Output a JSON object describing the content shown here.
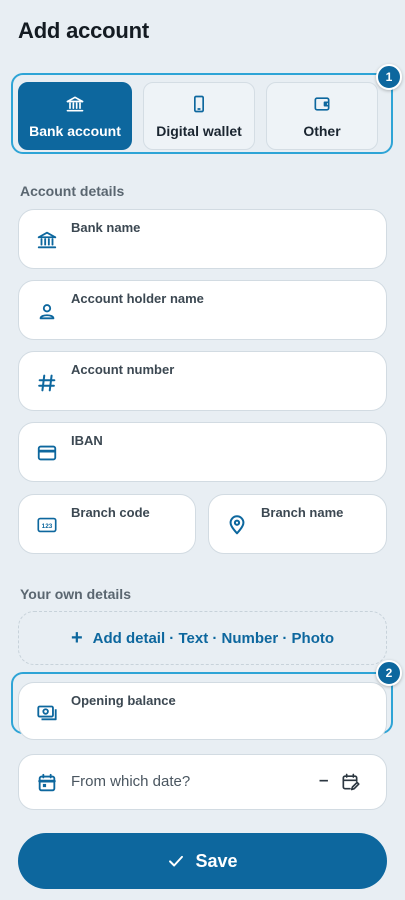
{
  "header": {
    "title": "Add account"
  },
  "account_types": [
    {
      "label": "Bank account",
      "icon": "bank-icon",
      "selected": true
    },
    {
      "label": "Digital wallet",
      "icon": "phone-icon",
      "selected": false
    },
    {
      "label": "Other",
      "icon": "wallet-icon",
      "selected": false
    }
  ],
  "badges": [
    "1",
    "2"
  ],
  "account_details": {
    "section_label": "Account details",
    "bank_name": "Bank name",
    "holder_name": "Account holder name",
    "account_number": "Account number",
    "iban": "IBAN",
    "branch_code": "Branch code",
    "branch_name": "Branch name"
  },
  "own_details": {
    "section_label": "Your own details",
    "add_detail": "Add detail · Text · Number · Photo",
    "add_symbol": "+",
    "opening_balance": "Opening balance",
    "date_placeholder": "From which date?",
    "date_value": "–"
  },
  "footer": {
    "save_label": "Save"
  },
  "colors": {
    "accent": "#0d679e",
    "highlight": "#2ea4d6",
    "background": "#e8eef3"
  }
}
